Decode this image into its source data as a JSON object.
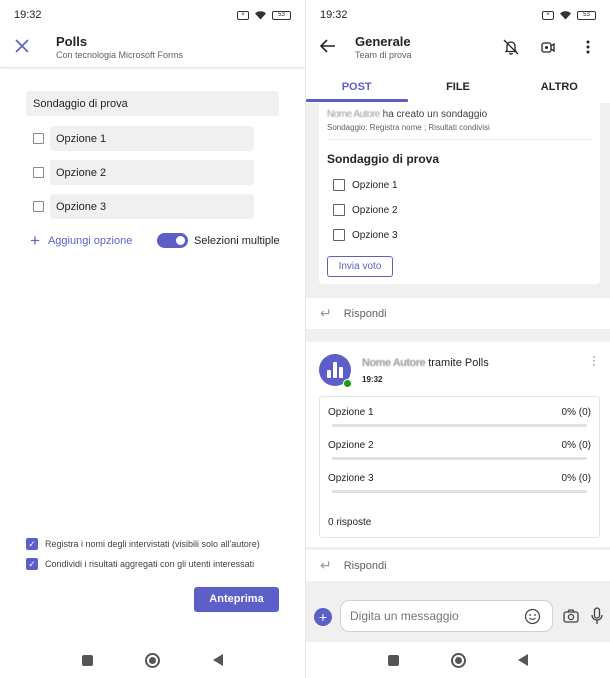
{
  "status_bar": {
    "left_time": "19:32",
    "right_time": "19:32",
    "battery": "53"
  },
  "polls_form": {
    "title": "Polls",
    "subtitle": "Con tecnologia Microsoft Forms",
    "question": "Sondaggio di prova",
    "options": [
      "Opzione 1",
      "Opzione 2",
      "Opzione 3"
    ],
    "add_option_label": "Aggiungi opzione",
    "multiple_selection_label": "Selezioni multiple",
    "multiple_selection_on": true,
    "settings": [
      {
        "label": "Registra i nomi degli intervistati (visibili solo all'autore)",
        "checked": true
      },
      {
        "label": "Condividi i risultati aggregati con gli utenti interessati",
        "checked": true
      }
    ],
    "preview_button": "Anteprima"
  },
  "channel": {
    "title": "Generale",
    "subtitle": "Team di prova",
    "tabs": [
      {
        "label": "POST",
        "active": true
      },
      {
        "label": "FILE",
        "active": false
      },
      {
        "label": "ALTRO",
        "active": false
      }
    ]
  },
  "poll_card": {
    "author_redacted": "Nome Autore",
    "created_text": " ha creato un sondaggio",
    "meta": "Sondaggio: Registra nome ; Risultati condivisi",
    "question": "Sondaggio di prova",
    "options": [
      "Opzione 1",
      "Opzione 2",
      "Opzione 3"
    ],
    "vote_button": "Invia voto"
  },
  "reply_label": "Rispondi",
  "results_card": {
    "sender_redacted": "Nome Autore",
    "via_text": " tramite Polls",
    "time": "19:32",
    "results": [
      {
        "label": "Opzione 1",
        "percent": "0% (0)",
        "fill": 0
      },
      {
        "label": "Opzione 2",
        "percent": "0% (0)",
        "fill": 0
      },
      {
        "label": "Opzione 3",
        "percent": "0% (0)",
        "fill": 0
      }
    ],
    "responses": "0 risposte"
  },
  "composer": {
    "placeholder": "Digita un messaggio"
  },
  "colors": {
    "accent": "#5b5fc7",
    "presence": "#13a10e"
  }
}
